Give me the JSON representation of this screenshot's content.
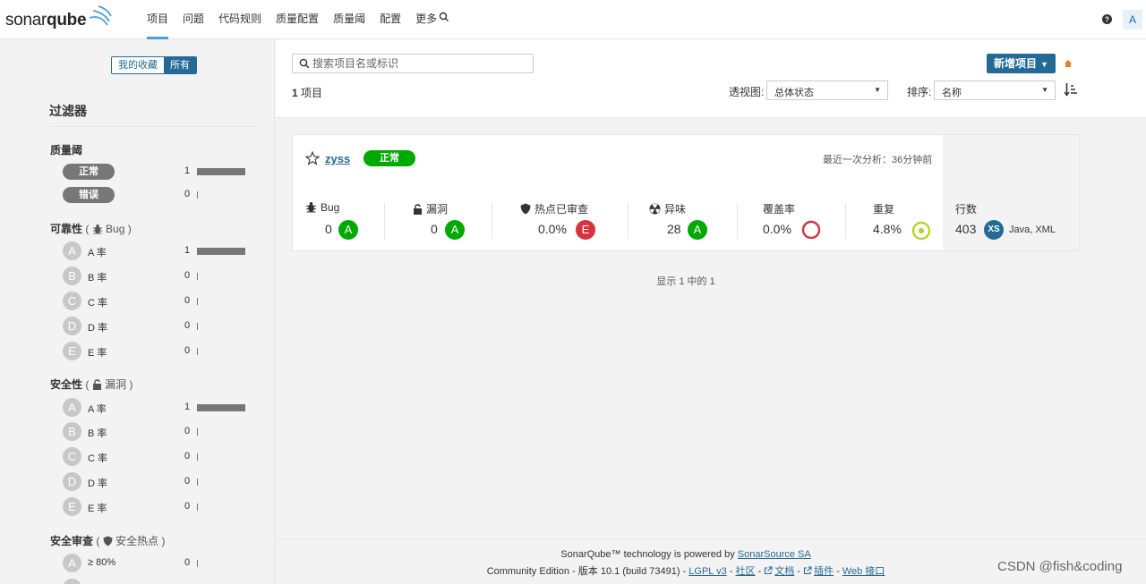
{
  "logo": {
    "text_light": "sonar",
    "text_bold": "qube"
  },
  "nav": {
    "items": [
      "项目",
      "问题",
      "代码规则",
      "质量配置",
      "质量阈",
      "配置",
      "更多"
    ],
    "avatar": "A"
  },
  "sidebar": {
    "favorite_label": "我的收藏",
    "all_label": "所有",
    "filter_title": "过滤器",
    "quality_gate": {
      "title": "质量阈",
      "items": [
        {
          "label": "正常",
          "count": "1",
          "fraction": 1
        },
        {
          "label": "错误",
          "count": "0",
          "fraction": 0
        }
      ]
    },
    "reliability": {
      "title": "可靠性",
      "open": " ( ",
      "sub": "Bug",
      "close": " )",
      "items": [
        {
          "grade": "A",
          "label": "A 率",
          "count": "1",
          "fraction": 1
        },
        {
          "grade": "B",
          "label": "B 率",
          "count": "0",
          "fraction": 0
        },
        {
          "grade": "C",
          "label": "C 率",
          "count": "0",
          "fraction": 0
        },
        {
          "grade": "D",
          "label": "D 率",
          "count": "0",
          "fraction": 0
        },
        {
          "grade": "E",
          "label": "E 率",
          "count": "0",
          "fraction": 0
        }
      ]
    },
    "security": {
      "title": "安全性",
      "open": " ( ",
      "sub": "漏洞",
      "close": " )",
      "items": [
        {
          "grade": "A",
          "label": "A 率",
          "count": "1",
          "fraction": 1
        },
        {
          "grade": "B",
          "label": "B 率",
          "count": "0",
          "fraction": 0
        },
        {
          "grade": "C",
          "label": "C 率",
          "count": "0",
          "fraction": 0
        },
        {
          "grade": "D",
          "label": "D 率",
          "count": "0",
          "fraction": 0
        },
        {
          "grade": "E",
          "label": "E 率",
          "count": "0",
          "fraction": 0
        }
      ]
    },
    "security_review": {
      "title": "安全审查",
      "open": " ( ",
      "sub": "安全热点",
      "close": " )",
      "items": [
        {
          "grade": "A",
          "label": "≥ 80%",
          "count": "0",
          "fraction": 0
        }
      ]
    }
  },
  "main": {
    "search_placeholder": "搜索项目名或标识",
    "project_count": "1",
    "project_count_suffix": " 项目",
    "new_project_label": "新增项目",
    "view_label": "透视图:",
    "view_value": "总体状态",
    "sort_label": "排序:",
    "sort_value": "名称"
  },
  "project": {
    "name": "zyss",
    "quality_gate": "正常",
    "last_analysis": "最近一次分析：36分钟前",
    "metrics": {
      "bugs": {
        "label": "Bug",
        "value": "0",
        "rating": "A"
      },
      "vulnerabilities": {
        "label": "漏洞",
        "value": "0",
        "rating": "A"
      },
      "hotspots": {
        "label": "热点已审查",
        "value": "0.0%",
        "rating": "E"
      },
      "smells": {
        "label": "异味",
        "value": "28",
        "rating": "A"
      },
      "coverage": {
        "label": "覆盖率",
        "value": "0.0%"
      },
      "duplications": {
        "label": "重复",
        "value": "4.8%"
      },
      "lines": {
        "label": "行数",
        "value": "403",
        "size": "XS",
        "languages": "Java, XML"
      }
    }
  },
  "showing": "显示 1 中的 1",
  "footer": {
    "line1_prefix": "SonarQube™ technology is powered by ",
    "line1_link": "SonarSource SA",
    "edition": "Community Edition - 版本 10.1 (build 73491) - ",
    "lgpl": "LGPL v3",
    "sep": " - ",
    "community": "社区",
    "docs": "文档",
    "plugins": "插件",
    "api": "Web 接口"
  },
  "watermark": "CSDN @fish&coding",
  "colors": {
    "accent": "#236a97",
    "ok": "#00aa00",
    "error": "#d4333f",
    "coverage_ring": "#d4333f",
    "duplication_ring": "#b0d513"
  }
}
